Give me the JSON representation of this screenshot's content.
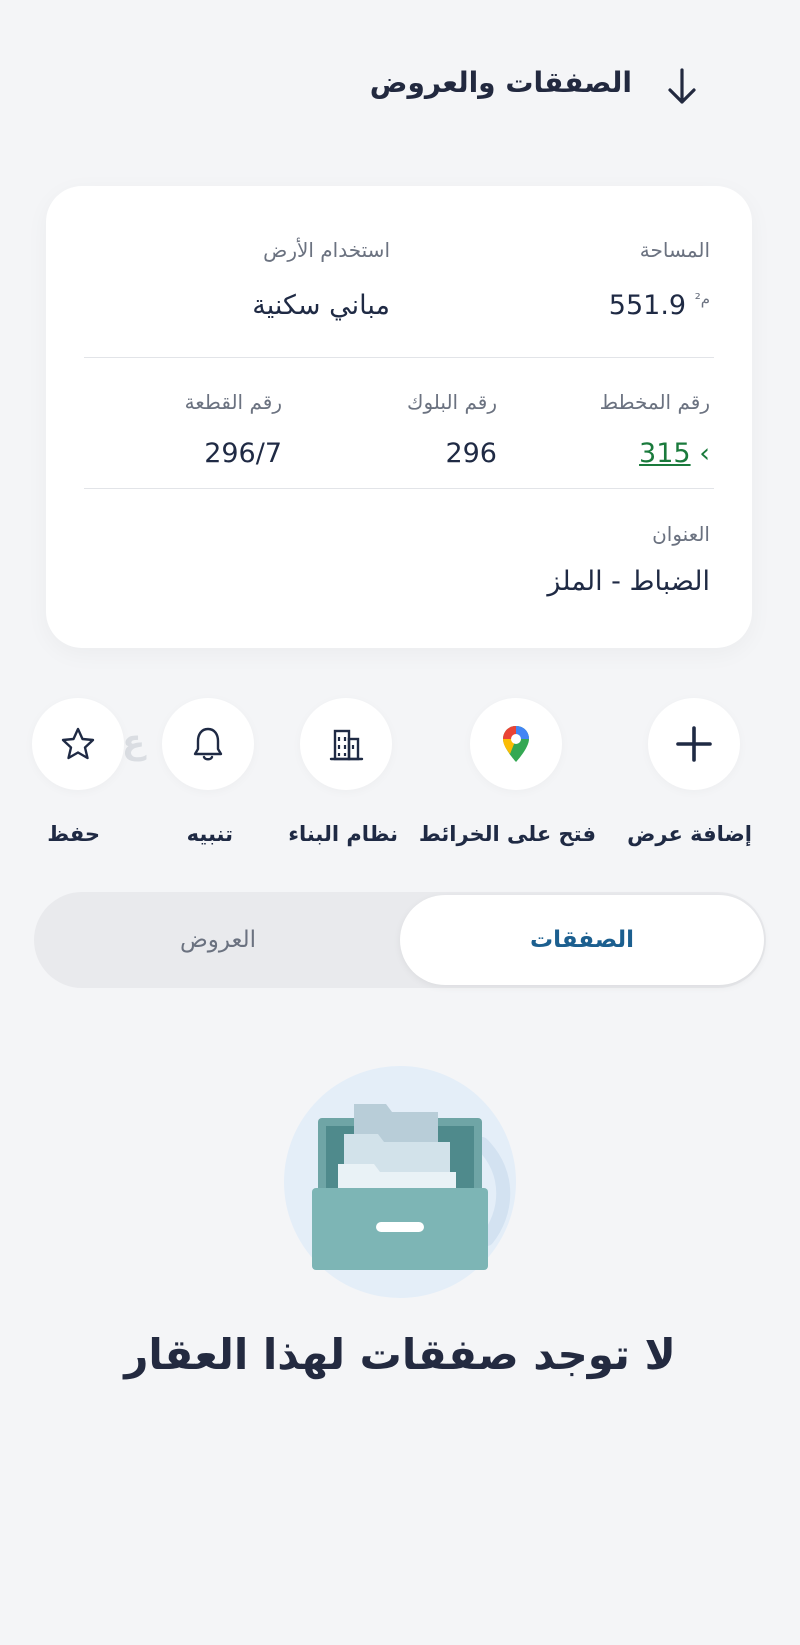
{
  "header": {
    "title": "الصفقات والعروض",
    "back_icon": "arrow-down-icon"
  },
  "details": {
    "area_label": "المساحة",
    "area_value": "551.9",
    "area_unit": "م²",
    "land_use_label": "استخدام الأرض",
    "land_use_value": "مباني سكنية",
    "plan_label": "رقم المخطط",
    "plan_value": "315",
    "block_label": "رقم البلوك",
    "block_value": "296",
    "parcel_label": "رقم القطعة",
    "parcel_value": "296/7",
    "address_label": "العنوان",
    "address_value": "الضباط - الملز"
  },
  "actions": [
    {
      "label": "إضافة عرض",
      "icon": "plus-icon"
    },
    {
      "label": "فتح على الخرائط",
      "icon": "map-pin-icon"
    },
    {
      "label": "نظام البناء",
      "icon": "building-icon"
    },
    {
      "label": "تنبيه",
      "icon": "bell-icon"
    },
    {
      "label": "حفظ",
      "icon": "star-icon"
    }
  ],
  "tabs": {
    "active": "الصفقات",
    "inactive": "العروض"
  },
  "empty_state": {
    "illustration": "file-drawer-icon",
    "message": "لا توجد صفقات لهذا العقار"
  },
  "colors": {
    "accent_blue": "#1c5f8f",
    "link_green": "#1a7a3c",
    "background": "#f4f5f7"
  }
}
